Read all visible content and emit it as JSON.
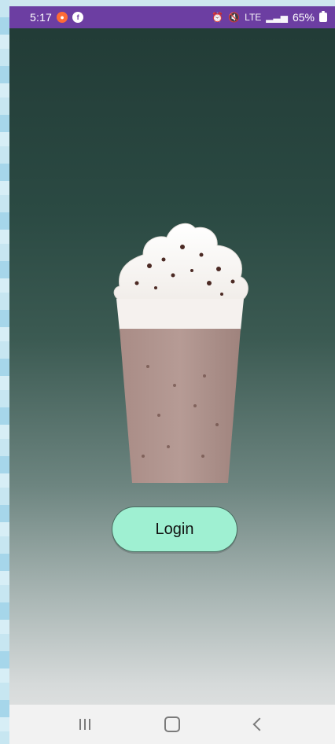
{
  "status_bar": {
    "time": "5:17",
    "notifications": [
      {
        "name": "recorder-notification-icon",
        "glyph": "●"
      },
      {
        "name": "facebook-notification-icon",
        "glyph": "f"
      }
    ],
    "right_icons": [
      {
        "name": "alarm-icon",
        "glyph": "⏰"
      },
      {
        "name": "mute-icon",
        "glyph": "🔇"
      },
      {
        "name": "lte-icon",
        "glyph": "LTE"
      },
      {
        "name": "signal-icon",
        "glyph": "▂▃▅"
      }
    ],
    "battery_percent": "65%"
  },
  "main": {
    "login_label": "Login"
  },
  "nav": {
    "recent_label": "Recent apps",
    "home_label": "Home",
    "back_label": "Back"
  },
  "colors": {
    "status_bar": "#6c3ea2",
    "button_fill": "#9ff0d2"
  }
}
